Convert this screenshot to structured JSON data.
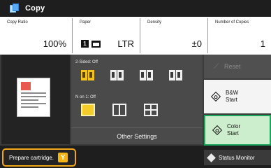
{
  "header": {
    "title": "Copy",
    "icon": "copy-icon"
  },
  "settings": {
    "copy_ratio": {
      "label": "Copy Ratio",
      "value": "100%"
    },
    "paper": {
      "label": "Paper",
      "drawer": "1",
      "value": "LTR"
    },
    "density": {
      "label": "Density",
      "value": "±0"
    },
    "copies": {
      "label": "Number of Copies",
      "value": "1"
    }
  },
  "options": {
    "two_sided_label": "2-Sided: Off",
    "n_on_1_label": "N on 1: Off",
    "other_settings": "Other Settings"
  },
  "actions": {
    "reset": "Reset",
    "bw_start_line1": "B&W",
    "bw_start_line2": "Start",
    "color_start_line1": "Color",
    "color_start_line2": "Start"
  },
  "footer": {
    "message": "Prepare cartridge.",
    "cartridge_badge": "Y",
    "status_monitor": "Status Monitor"
  },
  "colors": {
    "accent_yellow": "#f5c518",
    "warning_border": "#f0a81a",
    "color_start_green": "#1aa35a"
  }
}
